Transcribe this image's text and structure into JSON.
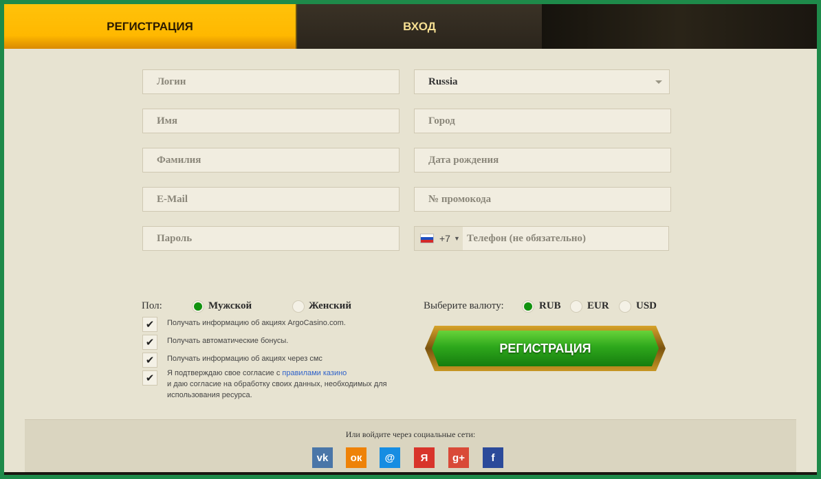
{
  "tabs": {
    "register": "РЕГИСТРАЦИЯ",
    "login": "ВХОД"
  },
  "form": {
    "login_placeholder": "Логин",
    "name_placeholder": "Имя",
    "surname_placeholder": "Фамилия",
    "email_placeholder": "E-Mail",
    "password_placeholder": "Пароль",
    "country_value": "Russia",
    "city_placeholder": "Город",
    "birthdate_placeholder": "Дата рождения",
    "promo_placeholder": "№ промокода",
    "phone_prefix": "+7",
    "phone_placeholder": "Телефон (не обязательно)"
  },
  "gender": {
    "label": "Пол:",
    "male": "Мужской",
    "female": "Женский",
    "selected": "male"
  },
  "currency": {
    "label": "Выберите валюту:",
    "options": [
      "RUB",
      "EUR",
      "USD"
    ],
    "selected": "RUB"
  },
  "checkboxes": [
    {
      "text": "Получать информацию об акциях ArgoCasino.com.",
      "checked": true
    },
    {
      "text": "Получать автоматические бонусы.",
      "checked": true
    },
    {
      "text": "Получать информацию об акциях через смс",
      "checked": true
    },
    {
      "text_before": "Я подтверждаю свое согласие с ",
      "link": "правилами казино",
      "text_after": "и даю согласие на обработку своих данных, необходимых для использования ресурса.",
      "checked": true
    }
  ],
  "submit_label": "РЕГИСТРАЦИЯ",
  "social": {
    "title": "Или войдите через социальные сети:",
    "icons": [
      {
        "name": "vk-icon",
        "glyph": "vk",
        "color": "#4a76a8"
      },
      {
        "name": "odnoklassniki-icon",
        "glyph": "ок",
        "color": "#ee8208"
      },
      {
        "name": "mailru-icon",
        "glyph": "@",
        "color": "#168de2"
      },
      {
        "name": "yandex-icon",
        "glyph": "Я",
        "color": "#d8342b"
      },
      {
        "name": "google-plus-icon",
        "glyph": "g+",
        "color": "#d94a38"
      },
      {
        "name": "facebook-icon",
        "glyph": "f",
        "color": "#2b4a9a"
      }
    ]
  },
  "colors": {
    "accent_yellow": "#ffbf00",
    "accent_green": "#11920f",
    "background": "#e7e3d1",
    "frame": "#1e8a4a"
  }
}
